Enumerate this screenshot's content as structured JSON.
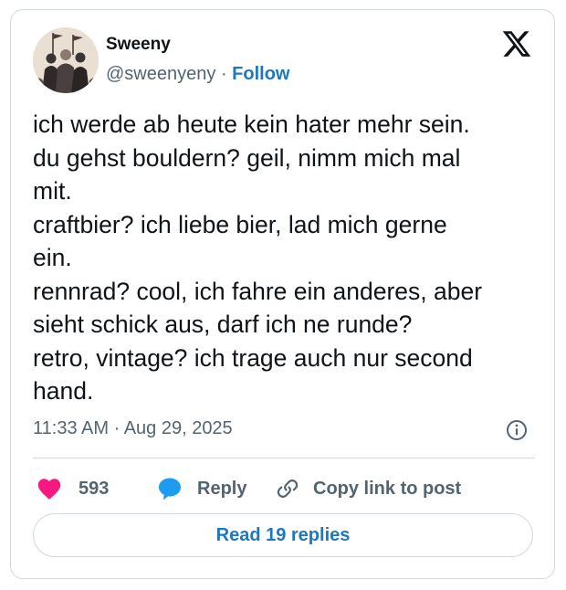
{
  "author": {
    "name": "Sweeny",
    "handle": "@sweenyeny",
    "separator": "·",
    "follow_label": "Follow"
  },
  "tweet": {
    "lines": [
      "ich werde ab heute kein hater mehr sein.",
      "du gehst bouldern? geil, nimm mich mal",
      "mit.",
      "craftbier? ich liebe bier, lad mich gerne",
      "ein.",
      "rennrad? cool, ich fahre ein anderes, aber",
      "sieht schick aus, darf ich ne runde?",
      "retro, vintage? ich trage auch nur second",
      "hand."
    ],
    "timestamp": "11:33 AM · Aug 29, 2025"
  },
  "actions": {
    "likes": "593",
    "reply_label": "Reply",
    "copy_label": "Copy link to post"
  },
  "read_replies_label": "Read 19 replies",
  "icons": {
    "logo": "x-logo-icon",
    "info": "info-icon",
    "like": "heart-icon",
    "reply": "speech-bubble-icon",
    "copy": "link-icon"
  },
  "colors": {
    "accent": "#1d78c1",
    "heart": "#f91880",
    "reply_bubble": "#1d9bf0",
    "muted": "#536471",
    "border": "#cfd9de"
  }
}
